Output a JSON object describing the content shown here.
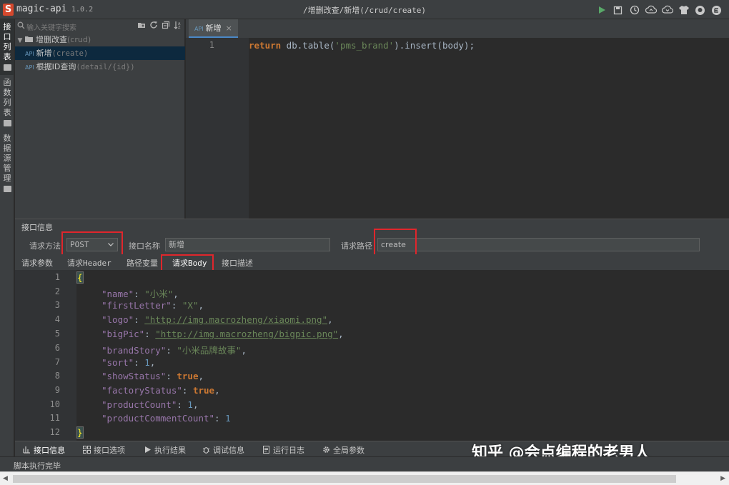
{
  "titlebar": {
    "logo_letter": "S",
    "app_name": "magic-api",
    "version": "1.0.2",
    "path": "/增删改查/新增(/crud/create)",
    "icons": [
      "run-icon",
      "save-icon",
      "history-icon",
      "upload-icon",
      "download-icon",
      "skin-icon",
      "github-icon",
      "gitee-icon"
    ]
  },
  "vtabs": [
    {
      "label": "接口列表",
      "active": true
    },
    {
      "label": "函数列表",
      "active": false
    },
    {
      "label": "数据源管理",
      "active": false
    }
  ],
  "tree": {
    "search_placeholder": "输入关键字搜索",
    "group": {
      "name": "增删改查",
      "path": "(crud)"
    },
    "items": [
      {
        "tag": "API",
        "name": "新增",
        "path": "(create)",
        "selected": true
      },
      {
        "tag": "API",
        "name": "根据ID查询",
        "path": "(detail/{id})",
        "selected": false
      }
    ]
  },
  "editor": {
    "tab": {
      "tag": "API",
      "label": "新增",
      "close": "×"
    },
    "line_number": "1",
    "code": {
      "kw": "return",
      "pre": " db.table(",
      "str": "'pms_brand'",
      "post": ").insert(body);"
    }
  },
  "info": {
    "header": "接口信息",
    "method_label": "请求方法",
    "method_value": "POST",
    "name_label": "接口名称",
    "name_value": "新增",
    "path_label": "请求路径",
    "path_value": "create",
    "subtabs": [
      "请求参数",
      "请求Header",
      "路径变量",
      "请求Body",
      "接口描述"
    ],
    "active_subtab": "请求Body"
  },
  "body_json": {
    "line_numbers": [
      "1",
      "2",
      "3",
      "4",
      "5",
      "6",
      "7",
      "8",
      "9",
      "10",
      "11",
      "12"
    ],
    "open_brace": "{",
    "close_brace": "}",
    "entries": [
      {
        "key": "\"name\"",
        "value": "\"小米\"",
        "type": "str",
        "comma": ","
      },
      {
        "key": "\"firstLetter\"",
        "value": "\"X\"",
        "type": "str",
        "comma": ","
      },
      {
        "key": "\"logo\"",
        "value": "\"http://img.macrozheng/xiaomi.png\"",
        "type": "url",
        "comma": ","
      },
      {
        "key": "\"bigPic\"",
        "value": "\"http://img.macrozheng/bigpic.png\"",
        "type": "url",
        "comma": ","
      },
      {
        "key": "\"brandStory\"",
        "value": "\"小米品牌故事\"",
        "type": "str",
        "comma": ","
      },
      {
        "key": "\"sort\"",
        "value": "1",
        "type": "num",
        "comma": ","
      },
      {
        "key": "\"showStatus\"",
        "value": "true",
        "type": "kw",
        "comma": ","
      },
      {
        "key": "\"factoryStatus\"",
        "value": "true",
        "type": "kw",
        "comma": ","
      },
      {
        "key": "\"productCount\"",
        "value": "1",
        "type": "num",
        "comma": ","
      },
      {
        "key": "\"productCommentCount\"",
        "value": "1",
        "type": "num",
        "comma": ""
      }
    ]
  },
  "bottom_tabs": [
    "接口信息",
    "接口选项",
    "执行结果",
    "调试信息",
    "运行日志",
    "全局参数"
  ],
  "watermark": "知乎 @会点编程的老男人",
  "status": "脚本执行完毕",
  "colors": {
    "accent": "#4a88c7",
    "highlight_box": "#e0262c",
    "keyword": "#cc7832",
    "string": "#6a8759",
    "number": "#6897bb",
    "json_key": "#9876aa"
  }
}
